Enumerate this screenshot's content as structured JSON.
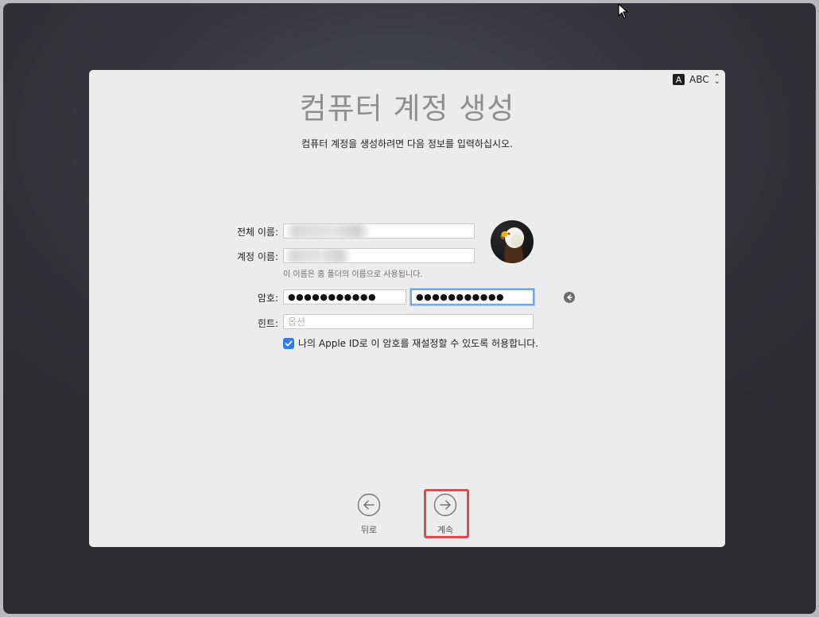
{
  "input_source": {
    "badge": "A",
    "label": "ABC",
    "arrows_up": "⌃",
    "arrows_down": "⌄"
  },
  "title": "컴퓨터 계정 생성",
  "subtitle": "컴퓨터 계정을 생성하려면 다음 정보를 입력하십시오.",
  "form": {
    "full_name": {
      "label": "전체 이름:",
      "value": ""
    },
    "account_name": {
      "label": "계정 이름:",
      "value": "",
      "help": "이 이름은 홈 폴더의 이름으로 사용됩니다."
    },
    "password": {
      "label": "암호:",
      "value": "●●●●●●●●●●●",
      "verify_value": "●●●●●●●●●●●"
    },
    "hint": {
      "label": "힌트:",
      "placeholder": "옵션"
    },
    "allow_reset": {
      "label": "나의 Apple ID로 이 암호를 재설정할 수 있도록 허용합니다.",
      "checked": true
    }
  },
  "nav": {
    "back": "뒤로",
    "continue": "계속"
  },
  "colors": {
    "accent": "#2f7bf0",
    "highlight": "#e8474d",
    "title": "#8f8f8f"
  },
  "icons": {
    "avatar": "eagle-avatar",
    "clear": "delete-left-icon",
    "back": "arrow-left-circle-icon",
    "continue": "arrow-right-circle-icon"
  }
}
